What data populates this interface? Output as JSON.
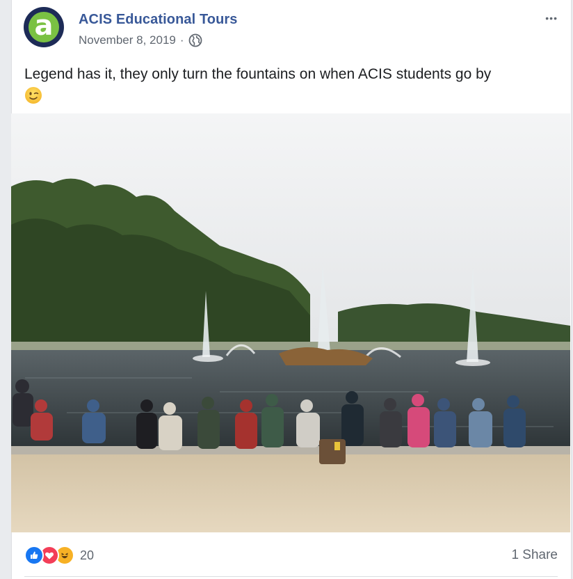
{
  "post": {
    "page_name": "ACIS Educational Tours",
    "date": "November 8, 2019",
    "date_separator": "·",
    "privacy_icon": "globe-icon",
    "menu_icon": "more-options-icon",
    "menu_label": "•••",
    "text": "Legend has it, they only turn the fountains on when ACIS students go by",
    "text_emoji": "winking-face-emoji",
    "avatar_letter": "a",
    "photo_description_icon": "photo-image"
  },
  "reactions": {
    "icons": [
      "like-icon",
      "love-icon",
      "haha-icon"
    ],
    "count": "20",
    "shares": "1 Share"
  },
  "colors": {
    "link": "#385898",
    "meta": "#606770",
    "like": "#1877f2",
    "love": "#f33e58",
    "haha": "#f7b125",
    "avatar_ring": "#1d2b57",
    "avatar_fill": "#7ac143"
  }
}
